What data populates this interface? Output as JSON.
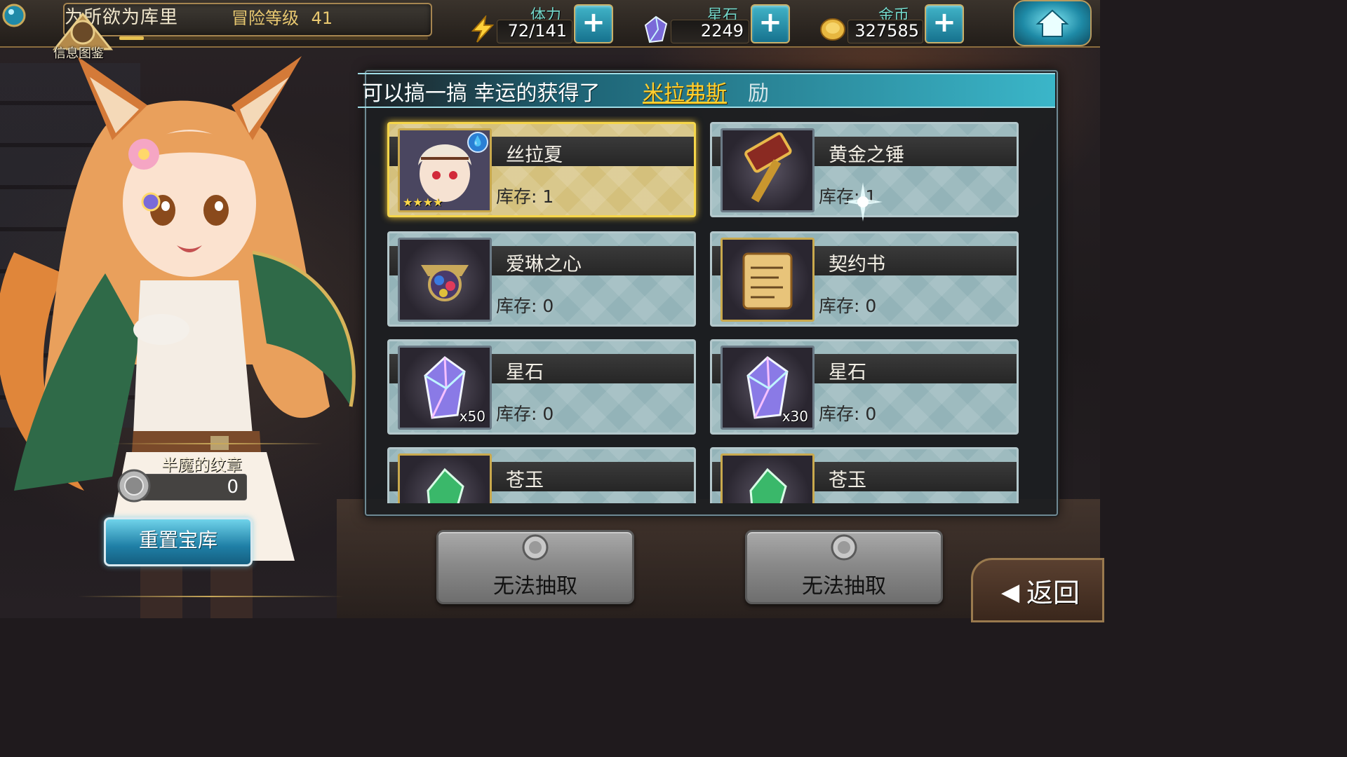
{
  "topbar": {
    "player_name": "为所欲为库里",
    "level_label": "冒险等级",
    "level_value": "41",
    "codex_label": "信息图鉴",
    "stamina": {
      "label": "体力",
      "value": "72/141"
    },
    "starstone": {
      "label": "星石",
      "value": "2249"
    },
    "gold": {
      "label": "金币",
      "value": "327585"
    },
    "plus_symbol": "+"
  },
  "banner": {
    "text": "可以搞一搞 幸运的获得了",
    "highlight": "米拉弗斯",
    "trail": "励"
  },
  "items": [
    {
      "name": "丝拉夏",
      "stock": "库存: 1",
      "qty": "",
      "stars": "★★★★",
      "element": "💧",
      "icon": "character-portrait-icon"
    },
    {
      "name": "黄金之锤",
      "stock": "库存: 1",
      "qty": "",
      "icon": "golden-hammer-icon"
    },
    {
      "name": "爱琳之心",
      "stock": "库存: 0",
      "qty": "",
      "icon": "jewel-heart-icon"
    },
    {
      "name": "契约书",
      "stock": "库存: 0",
      "qty": "",
      "icon": "scroll-icon"
    },
    {
      "name": "星石",
      "stock": "库存: 0",
      "qty": "x50",
      "icon": "star-crystal-icon"
    },
    {
      "name": "星石",
      "stock": "库存: 0",
      "qty": "x30",
      "icon": "star-crystal-icon"
    },
    {
      "name": "苍玉",
      "stock": "",
      "qty": "",
      "icon": "green-crystal-icon"
    },
    {
      "name": "苍玉",
      "stock": "",
      "qty": "",
      "icon": "green-crystal-icon"
    }
  ],
  "medal": {
    "title": "半魔的纹章",
    "count": "0"
  },
  "buttons": {
    "reset": "重置宝库",
    "draw_left": "无法抽取",
    "draw_right": "无法抽取",
    "back": "返回",
    "back_arrow": "◀"
  },
  "colors": {
    "accent_cyan": "#1f7fa6",
    "highlight_gold": "#ffcf30",
    "selected_border": "#f6d64a"
  }
}
